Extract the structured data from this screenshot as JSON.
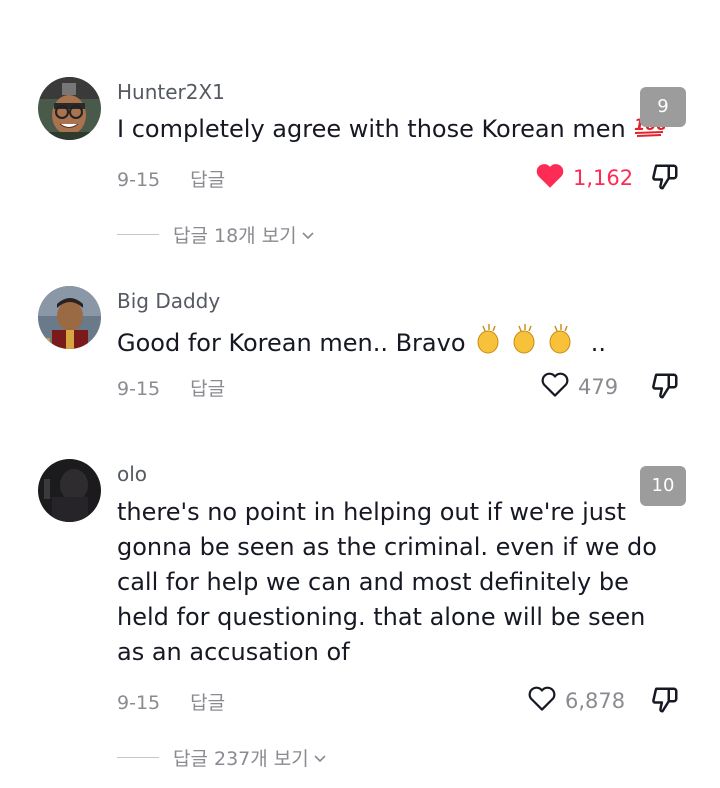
{
  "comments": [
    {
      "username": "Hunter2X1",
      "text": "I completely agree with those Korean men",
      "date": "9-15",
      "reply_label": "답글",
      "likes": "1,162",
      "liked": true,
      "badge": "9",
      "emoji": "100-emoji",
      "view_replies": "답글 18개 보기"
    },
    {
      "username": "Big Daddy",
      "text": "Good for Korean men.. Bravo",
      "suffix": "..",
      "date": "9-15",
      "reply_label": "답글",
      "likes": "479",
      "liked": false,
      "emoji": "clapping-hands-emoji"
    },
    {
      "username": "olo",
      "text": "there's no point in helping out if we're just gonna be seen as the criminal. even if we do call for help we can and most definitely be held for questioning. that alone will be seen as an accusation of",
      "date": "9-15",
      "reply_label": "답글",
      "likes": "6,878",
      "liked": false,
      "badge": "10",
      "view_replies": "답글 237개 보기"
    }
  ],
  "colors": {
    "liked": "#fe2c55",
    "muted": "#8a8b91",
    "badge": "#9c9c9c"
  }
}
